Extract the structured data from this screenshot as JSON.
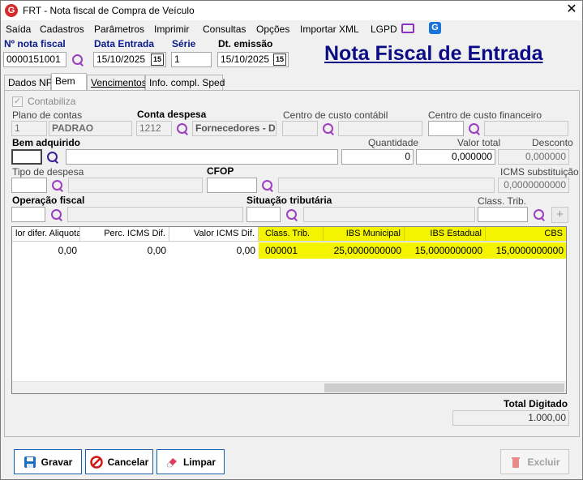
{
  "window": {
    "title": "FRT - Nota fiscal de Compra de Veículo",
    "app_icon": "G",
    "close": "✕"
  },
  "menu": [
    "Saída",
    "Cadastros",
    "Parâmetros",
    "Imprimir",
    "Consultas",
    "Opções",
    "Importar XML",
    "LGPD"
  ],
  "header": {
    "nota_label": "Nº nota fiscal",
    "nota_value": "0000151001",
    "entrada_label": "Data Entrada",
    "entrada_value": "15/10/2025",
    "serie_label": "Série",
    "serie_value": "1",
    "emissao_label": "Dt. emissão",
    "emissao_value": "15/10/2025",
    "calendar_glyph": "15",
    "big_title": "Nota Fiscal de Entrada"
  },
  "tabs": [
    {
      "label": "Dados NF"
    },
    {
      "label": "Bem"
    },
    {
      "label": "Vencimentos"
    },
    {
      "label": "Info. compl. Sped"
    }
  ],
  "form": {
    "contabiliza": "Contabiliza",
    "plano_label": "Plano de contas",
    "plano_code": "1",
    "plano_name": "PADRAO",
    "conta_label": "Conta despesa",
    "conta_code": "1212",
    "conta_name": "Fornecedores - D",
    "ccc_label": "Centro de custo contábil",
    "ccf_label": "Centro de custo financeiro",
    "bem_label": "Bem adquirido",
    "qtd_label": "Quantidade",
    "qtd_value": "0",
    "vt_label": "Valor total",
    "vt_value": "0,000000",
    "desc_label": "Desconto",
    "desc_value": "0,000000",
    "tipo_label": "Tipo de despesa",
    "cfop_label": "CFOP",
    "icms_label": "ICMS substituição",
    "icms_value": "0,0000000000",
    "opf_label": "Operação fiscal",
    "sit_label": "Situação tributária",
    "class_label": "Class. Trib."
  },
  "grid": {
    "headers": [
      "lor difer. Aliquota",
      "Perc. ICMS Dif.",
      "Valor ICMS Dif.",
      "Class. Trib.",
      "IBS Municipal",
      "IBS Estadual",
      "CBS"
    ],
    "row": [
      "0,00",
      "0,00",
      "0,00",
      "000001",
      "25,0000000000",
      "15,0000000000",
      "15,0000000000"
    ]
  },
  "total": {
    "label": "Total Digitado",
    "value": "1.000,00"
  },
  "buttons": {
    "gravar": "Gravar",
    "cancelar": "Cancelar",
    "limpar": "Limpar",
    "excluir": "Excluir"
  },
  "colors": {
    "highlight": "#f4f400",
    "title_blue": "#0b0b86",
    "label_blue": "#0a1a8c",
    "search_purple": "#9b3fbf"
  }
}
